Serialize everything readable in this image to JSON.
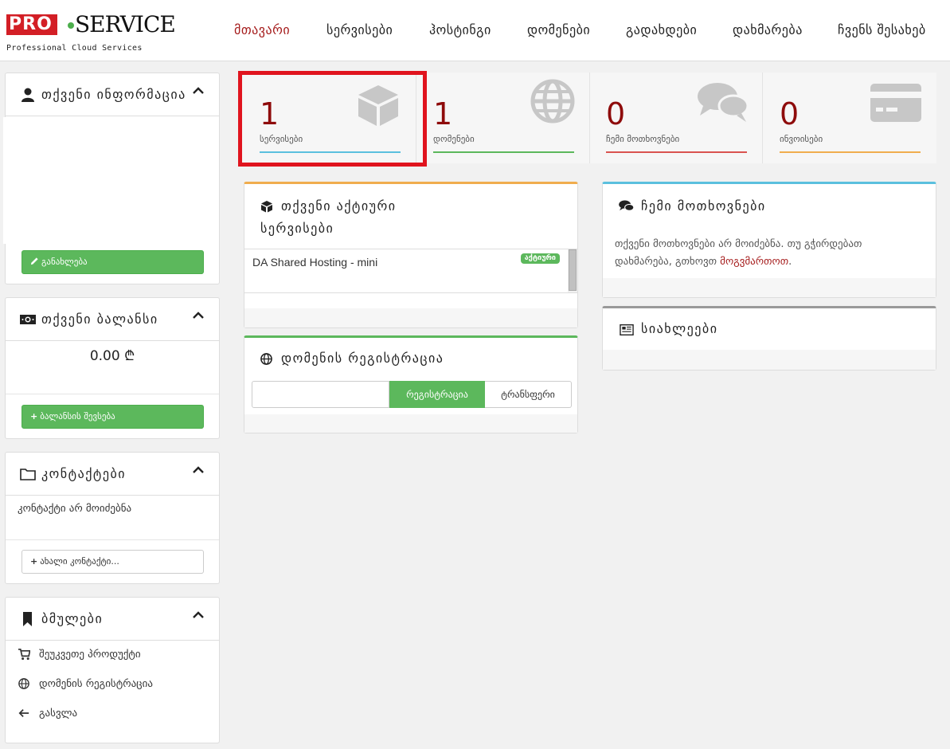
{
  "brand": {
    "logo_pro": "PRO",
    "logo_service": "SERVICE",
    "tagline": "Professional Cloud Services"
  },
  "nav": [
    {
      "label": "მთავარი",
      "active": true
    },
    {
      "label": "სერვისები"
    },
    {
      "label": "ჰოსტინგი"
    },
    {
      "label": "დომენები"
    },
    {
      "label": "გადახდები"
    },
    {
      "label": "დახმარება"
    },
    {
      "label": "ჩვენს შესახებ"
    }
  ],
  "sidebar": {
    "info": {
      "title": "თქვენი ინფორმაცია",
      "update_button": "განახლება"
    },
    "balance": {
      "title": "თქვენი ბალანსი",
      "amount": "0.00 ₾",
      "topup_button": "ბალანსის შევსება"
    },
    "contacts": {
      "title": "კონტაქტები",
      "empty_text": "კონტაქტი არ მოიძებნა",
      "new_button": "ახალი კონტაქტი..."
    },
    "bookmarks": {
      "title": "ბმულები",
      "items": [
        {
          "label": "შეუკვეთე პროდუქტი",
          "icon": "cart-icon"
        },
        {
          "label": "დომენის რეგისტრაცია",
          "icon": "globe-icon"
        },
        {
          "label": "გასვლა",
          "icon": "arrow-left-icon"
        }
      ]
    }
  },
  "stats": [
    {
      "value": "1",
      "label": "სერვისები",
      "color": "#5bc0de",
      "icon": "cube-icon"
    },
    {
      "value": "1",
      "label": "დომენები",
      "color": "#5cb85c",
      "icon": "globe-icon"
    },
    {
      "value": "0",
      "label": "ჩემი მოთხოვნები",
      "color": "#d9534f",
      "icon": "comments-icon"
    },
    {
      "value": "0",
      "label": "ინვოისები",
      "color": "#f0ad4e",
      "icon": "credit-card-icon"
    }
  ],
  "active_services": {
    "title_line1": "თქვენი აქტიური",
    "title_line2": "სერვისები",
    "items": [
      {
        "name": "DA Shared Hosting - mini",
        "status": "აქტიური"
      }
    ]
  },
  "domain_register": {
    "title": "დომენის რეგისტრაცია",
    "input_value": "",
    "register_button": "რეგისტრაცია",
    "transfer_button": "ტრანსფერი"
  },
  "tickets": {
    "title": "ჩემი მოთხოვნები",
    "text": "თქვენი მოთხოვნები არ მოიძებნა. თუ გჭირდებათ",
    "text2": "დახმარება, გთხოვთ",
    "link": "მოგვმართოთ",
    "tail": "."
  },
  "news": {
    "title": "სიახლეები"
  },
  "colors": {
    "accent": "#a51c1c",
    "green": "#5cb85c",
    "highlight": "#e0141e"
  }
}
